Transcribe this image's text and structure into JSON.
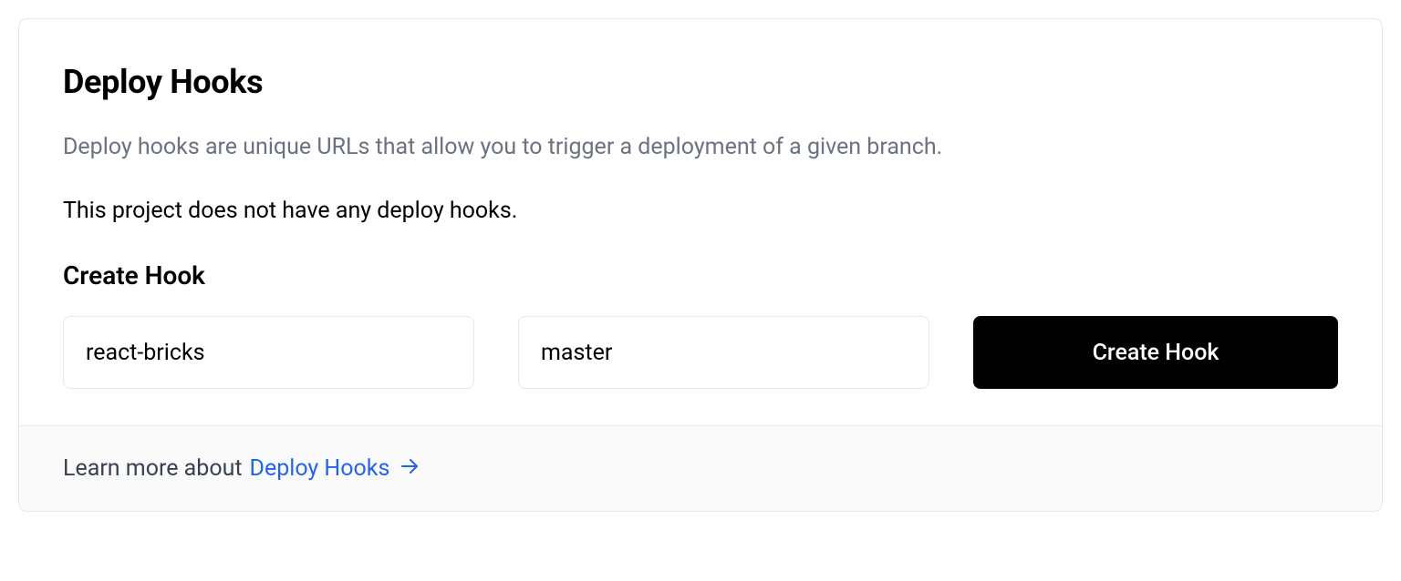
{
  "header": {
    "title": "Deploy Hooks",
    "description": "Deploy hooks are unique URLs that allow you to trigger a deployment of a given branch.",
    "status": "This project does not have any deploy hooks."
  },
  "create": {
    "heading": "Create Hook",
    "name_value": "react-bricks",
    "branch_value": "master",
    "button_label": "Create Hook"
  },
  "footer": {
    "prefix": "Learn more about",
    "link_label": "Deploy Hooks"
  }
}
